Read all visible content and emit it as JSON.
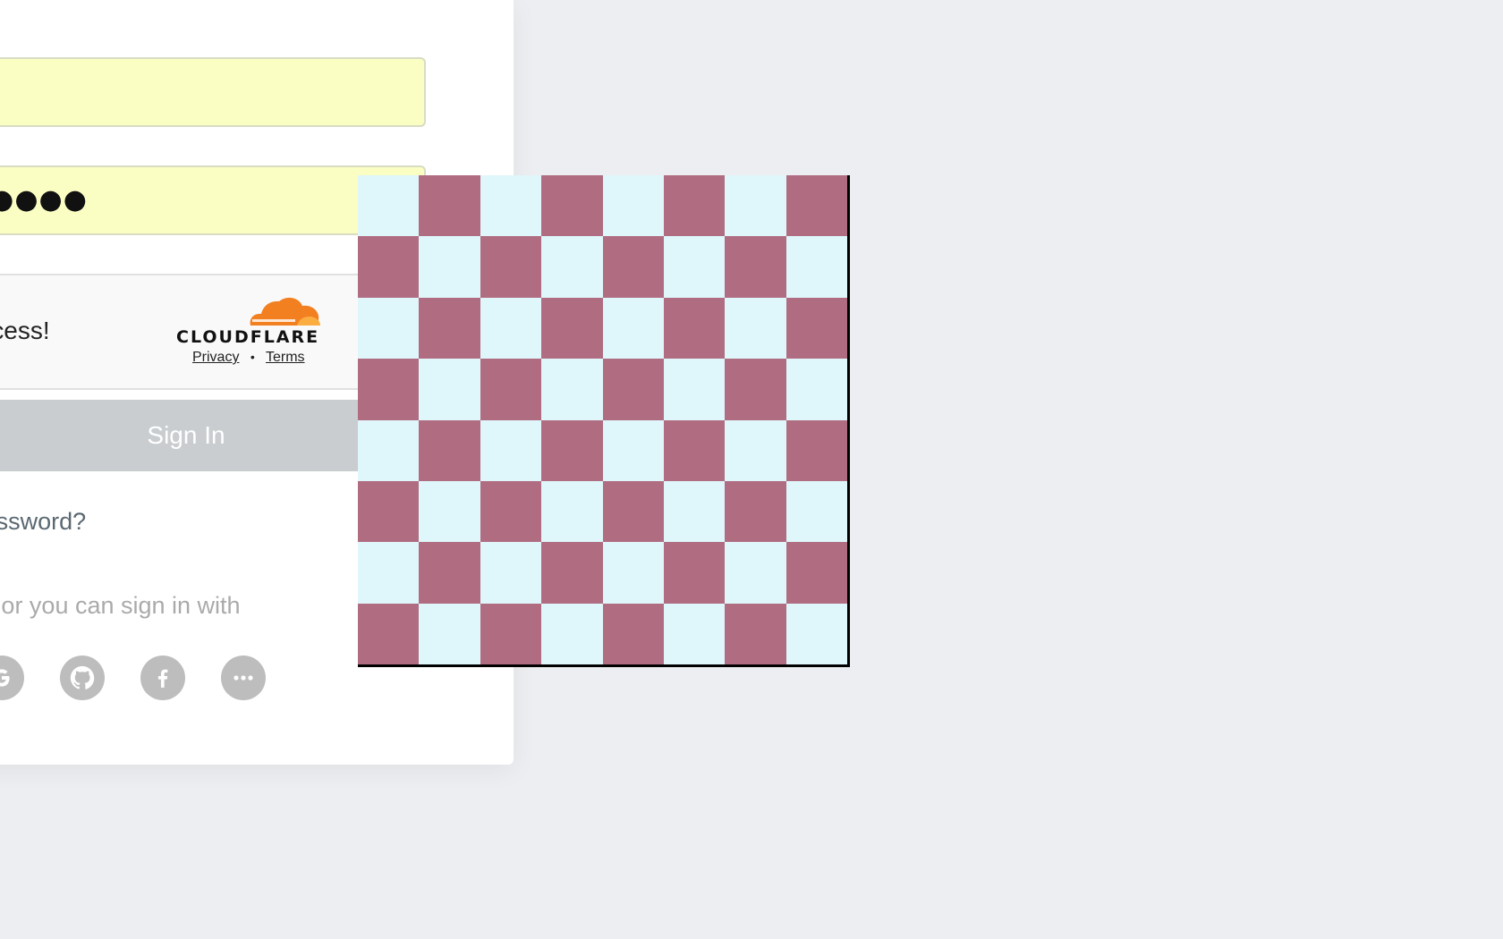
{
  "login": {
    "email_value": "",
    "password_value": "●●●●●",
    "captcha": {
      "status": "Success!",
      "brand": "CLOUDFLARE",
      "privacy_label": "Privacy",
      "separator": "•",
      "terms_label": "Terms"
    },
    "signin_label": "Sign In",
    "forgot_label": "Forgot password?",
    "alt_signin_label": "or you can sign in with",
    "social_icons": [
      "google-icon",
      "github-icon",
      "facebook-icon",
      "more-icon"
    ]
  },
  "board": {
    "rows": 8,
    "cols": 8,
    "light_color": "#dff7fb",
    "dark_color": "#b06d82"
  },
  "colors": {
    "background": "#edeef1",
    "field_fill": "#fbfec3",
    "button_disabled": "#c9cdd0",
    "cloudflare_orange": "#f38020"
  }
}
